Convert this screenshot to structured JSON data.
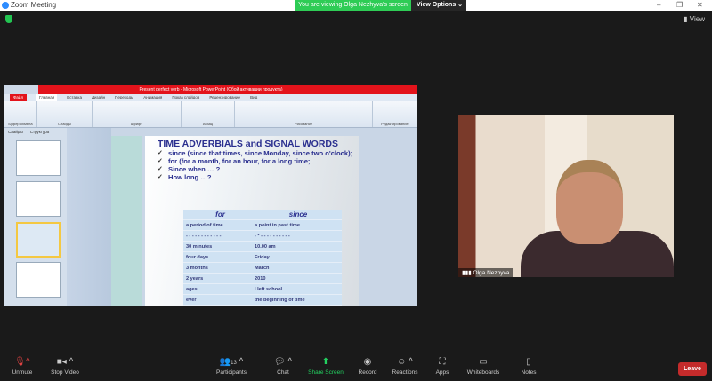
{
  "window": {
    "title": "Zoom Meeting",
    "banner": "You are viewing Olga Nezhyva's screen",
    "view_options": "View Options",
    "view": "View"
  },
  "ppt": {
    "title": "Present perfect verb - Microsoft PowerPoint (Сбой активации продукта)",
    "tabs": [
      "Файл",
      "Главная",
      "Вставка",
      "Дизайн",
      "Переходы",
      "Анимация",
      "Показ слайдов",
      "Рецензирование",
      "Вид"
    ],
    "groups": [
      "Буфер обмена",
      "Слайды",
      "Шрифт",
      "Абзац",
      "Рисование",
      "Редактирование"
    ],
    "panel_tabs": [
      "Слайды",
      "Структура"
    ]
  },
  "slide": {
    "title": "TIME ADVERBIALS and SIGNAL WORDS",
    "bullets": [
      "since (since that times, since Monday, since two o'clock);",
      "for (for a month, for an hour, for a long time;",
      "Since when … ?",
      "How long …?"
    ],
    "table": {
      "headers": [
        "for",
        "since"
      ],
      "rows": [
        [
          "a period of time",
          "a point in past time"
        ],
        [
          "- - - - - - - - - - - -",
          "- * - - - - - - - - - -"
        ],
        [
          "30 minutes",
          "10.00 am"
        ],
        [
          "four days",
          "Friday"
        ],
        [
          "3 months",
          "March"
        ],
        [
          "2 years",
          "2010"
        ],
        [
          "ages",
          "I left school"
        ],
        [
          "ever",
          "the beginning of time"
        ]
      ]
    }
  },
  "video": {
    "name": "Olga Nezhyva"
  },
  "toolbar": {
    "unmute": "Unmute",
    "stop_video": "Stop Video",
    "participants": "Participants",
    "participants_count": "13",
    "chat": "Chat",
    "share": "Share Screen",
    "record": "Record",
    "reactions": "Reactions",
    "apps": "Apps",
    "whiteboards": "Whiteboards",
    "notes": "Notes",
    "leave": "Leave"
  },
  "colors": {
    "share_green": "#23d160",
    "leave_red": "#c42b2b",
    "banner_green": "#2ecc55"
  }
}
